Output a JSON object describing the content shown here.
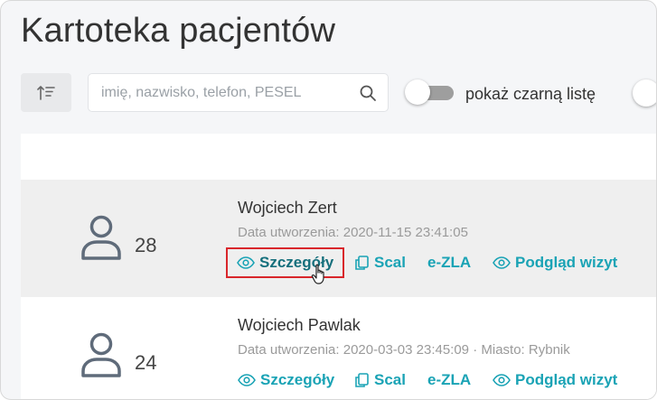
{
  "page": {
    "title": "Kartoteka pacjentów"
  },
  "toolbar": {
    "search_placeholder": "imię, nazwisko, telefon, PESEL",
    "search_value": "",
    "blacklist_toggle_label": "pokaż czarną listę",
    "blacklist_toggle_on": false
  },
  "patients": [
    {
      "name": "Wojciech Zert",
      "age": "28",
      "created_label": "Data utworzenia:",
      "created_value": "2020-11-15 23:41:05",
      "city_sep": "",
      "city_label": "",
      "city_value": "",
      "actions": {
        "details": "Szczegóły",
        "merge": "Scal",
        "ezla": "e-ZLA",
        "visits": "Podgląd wizyt"
      }
    },
    {
      "name": "Wojciech Pawlak",
      "age": "24",
      "created_label": "Data utworzenia:",
      "created_value": "2020-03-03 23:45:09",
      "city_sep": "·",
      "city_label": "Miasto:",
      "city_value": "Rybnik",
      "actions": {
        "details": "Szczegóły",
        "merge": "Scal",
        "ezla": "e-ZLA",
        "visits": "Podgląd wizyt"
      }
    }
  ],
  "colors": {
    "accent": "#1aa3b5",
    "highlight_border": "#d9262b",
    "muted_text": "#9a9a9a"
  },
  "icons": {
    "sort": "sort-icon",
    "search": "search-icon",
    "avatar": "user-icon",
    "details": "eye-icon",
    "merge": "copy-icon",
    "visits": "eye-icon",
    "cursor": "hand-pointer-icon"
  }
}
